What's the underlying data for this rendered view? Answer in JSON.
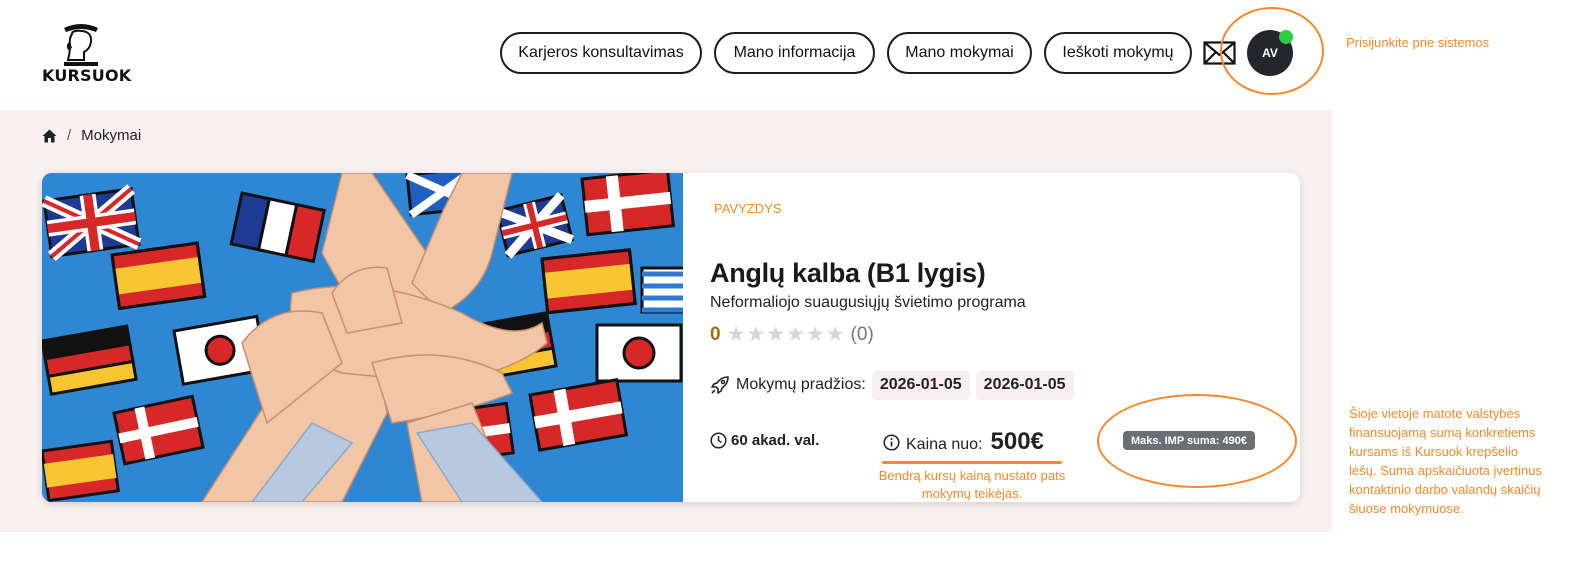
{
  "brand": {
    "logo_text": "KURSUOK"
  },
  "nav": {
    "items": [
      {
        "label": "Karjeros konsultavimas"
      },
      {
        "label": "Mano informacija"
      },
      {
        "label": "Mano mokymai"
      },
      {
        "label": "Ieškoti mokymų"
      }
    ],
    "avatar_initials": "AV",
    "icons": {
      "mail": "mail-icon",
      "online_status": "online-dot"
    }
  },
  "annotations": {
    "login_note": "Prisijunkite prie sistemos",
    "imp_note": "Šioje vietoje matote valstybės finansuojamą sumą konkretiems kursams iš Kursuok krepšelio lėšų. Suma apskaičiuota įvertinus kontaktinio darbo valandų skaičių šiuose mokymuose.",
    "price_note": "Bendrą kursų kainą nustato pats mokymų teikėjas.",
    "accent_color": "#f28a2e"
  },
  "breadcrumb": {
    "home_icon": "home-icon",
    "current": "Mokymai",
    "separator": "/"
  },
  "course": {
    "tag": "PAVYZDYS",
    "title": "Anglų kalba (B1 lygis)",
    "subtitle": "Neformaliojo suaugusiųjų švietimo programa",
    "rating": {
      "score": "0",
      "stars_filled": 0,
      "stars_total": 6,
      "count": "(0)"
    },
    "start_label": "Mokymų pradžios:",
    "start_dates": [
      "2026-01-05",
      "2026-01-05"
    ],
    "hours": "60 akad. val.",
    "price_label": "Kaina nuo:",
    "price_value": "500€",
    "imp_badge": "Maks. IMP suma: 490€"
  }
}
